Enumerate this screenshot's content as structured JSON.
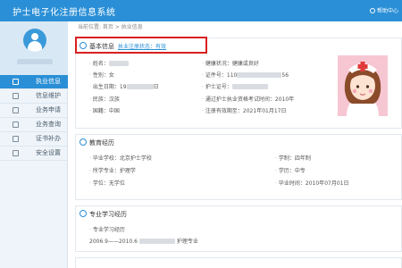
{
  "header": {
    "title": "护士电子化注册信息系统",
    "help": "帮助中心"
  },
  "breadcrumb": "当前位置: 首页 > 执业信息",
  "sidebar": {
    "items": [
      {
        "label": "执业信息",
        "icon": "info-icon",
        "active": true
      },
      {
        "label": "信息维护",
        "icon": "edit-icon"
      },
      {
        "label": "业务申请",
        "icon": "apply-icon"
      },
      {
        "label": "业务查询",
        "icon": "query-icon"
      },
      {
        "label": "证书补办",
        "icon": "certificate-icon"
      },
      {
        "label": "安全设置",
        "icon": "lock-icon"
      }
    ]
  },
  "basic": {
    "title": "基本信息",
    "status_link": "执业注册状态：有效",
    "name": "姓名：",
    "gender": "性别：女",
    "birth": "出生日期：19",
    "birth_suffix": "日",
    "ethnic": "民族：汉族",
    "nationality": "国籍：中国",
    "health": "健康状况：健康或良好",
    "id_no": "证件号：110",
    "id_suffix": "56",
    "nurse_cert": "护士证号：",
    "exam": "通过护士执业资格考试时间：2010年",
    "expire": "注册有效期至：2021年01月17日"
  },
  "education": {
    "title": "教育经历",
    "school": "毕业学校：北京护士学校",
    "major": "所学专业：护理学",
    "degree": "学位：无学位",
    "system": "学制：四年制",
    "level": "学历：中专",
    "grad_time": "毕业时间：2010年07月01日"
  },
  "study": {
    "title": "专业学习经历",
    "sub": "专业学习经历",
    "record_prefix": "2006.9——2010.6",
    "record_suffix": "护理专业"
  },
  "colors": {
    "accent": "#2a8fd6",
    "highlight": "#d92020"
  }
}
